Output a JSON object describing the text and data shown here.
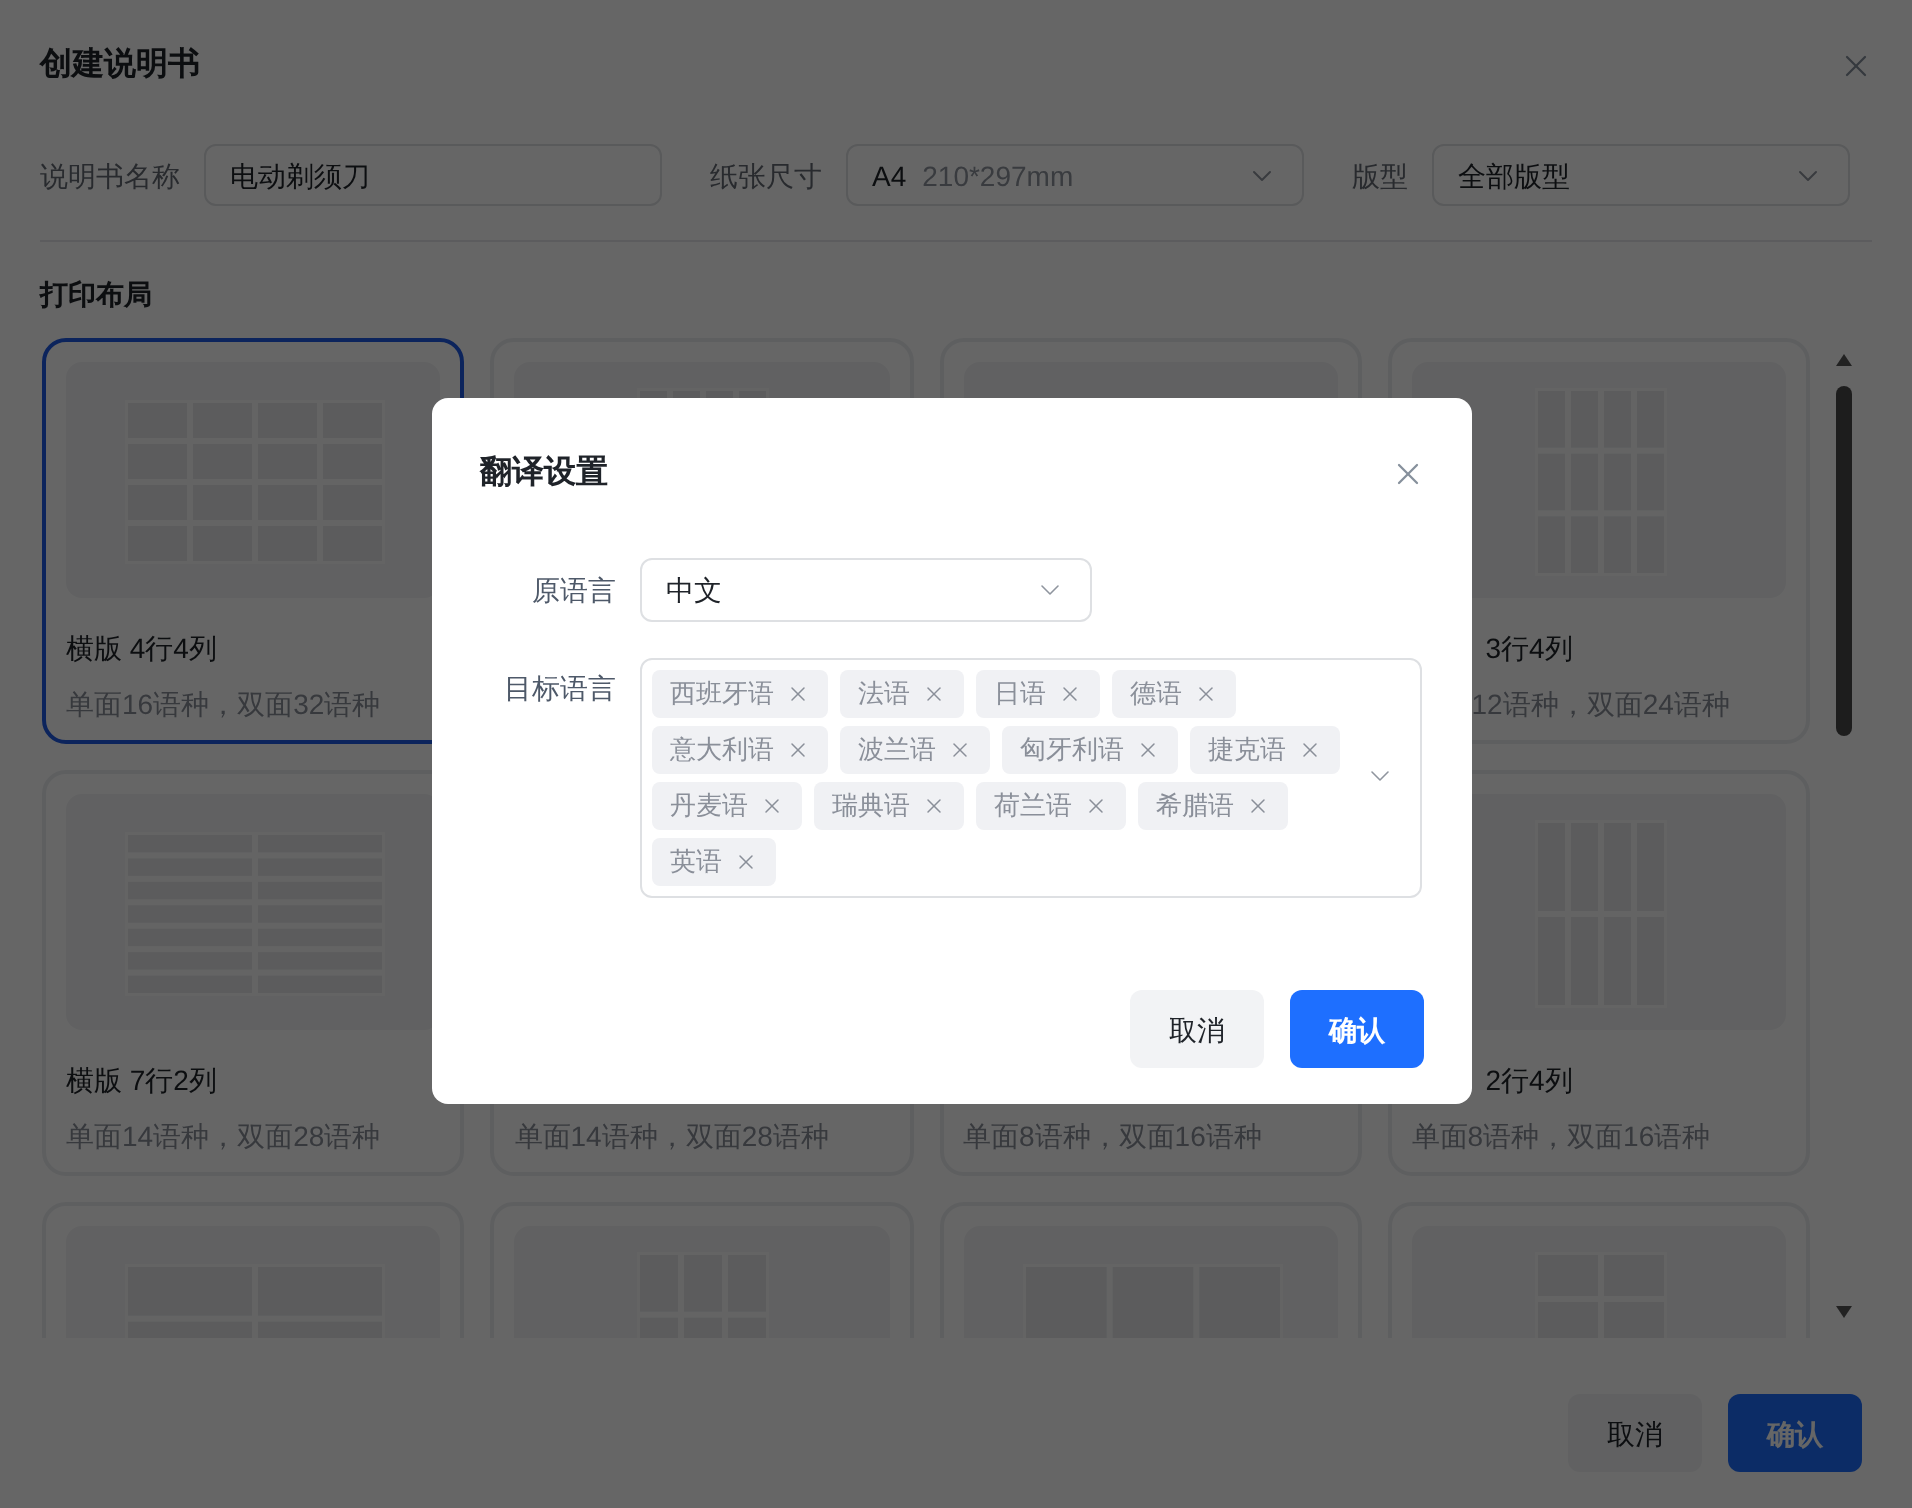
{
  "dialog": {
    "title": "创建说明书",
    "fields": [
      {
        "kind": "input",
        "label": "说明书名称",
        "value": "电动剃须刀"
      },
      {
        "kind": "select",
        "label": "纸张尺寸",
        "value": "A4",
        "detail": "210*297mm"
      },
      {
        "kind": "select",
        "label": "版型",
        "value": "全部版型"
      }
    ],
    "section_title": "打印布局",
    "layouts": [
      {
        "title": "横版 4行4列",
        "subtitle": "单面16语种，双面32语种",
        "selected": true
      },
      {
        "selected": false
      },
      {
        "selected": false
      },
      {
        "title": "3行4列",
        "subtitle": "12语种，双面24语种",
        "selected": false
      },
      {
        "title": "横版 7行2列",
        "subtitle": "单面14语种，双面28语种",
        "selected": false
      },
      {
        "subtitle": "单面14语种，双面28语种",
        "selected": false
      },
      {
        "subtitle": "单面8语种，双面16语种",
        "selected": false
      },
      {
        "title": "2行4列",
        "subtitle": "单面8语种，双面16语种",
        "selected": false
      },
      {
        "selected": false
      },
      {
        "selected": false
      },
      {
        "selected": false
      },
      {
        "selected": false
      }
    ],
    "buttons": [
      {
        "label": "取消",
        "kind": "secondary"
      },
      {
        "label": "确认",
        "kind": "primary"
      }
    ]
  },
  "translation_modal": {
    "title": "翻译设置",
    "source_label": "原语言",
    "source_value": "中文",
    "target_label": "目标语言",
    "target_languages": [
      "西班牙语",
      "法语",
      "日语",
      "德语",
      "意大利语",
      "波兰语",
      "匈牙利语",
      "捷克语",
      "丹麦语",
      "瑞典语",
      "荷兰语",
      "希腊语",
      "英语"
    ],
    "buttons": [
      {
        "label": "取消",
        "kind": "secondary"
      },
      {
        "label": "确认",
        "kind": "primary"
      }
    ]
  }
}
